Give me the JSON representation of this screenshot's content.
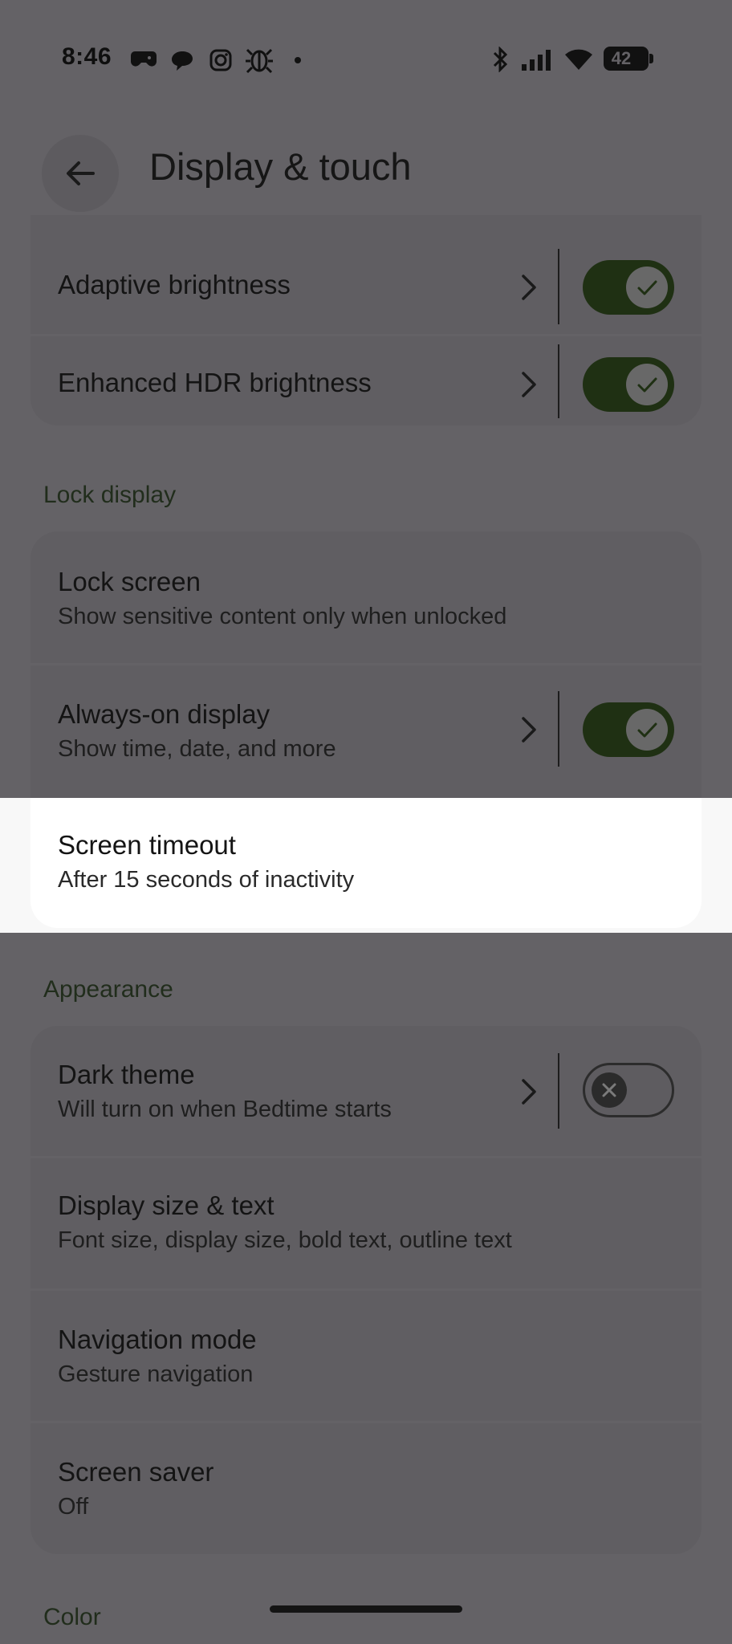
{
  "status_bar": {
    "time": "8:46",
    "battery": "42"
  },
  "header": {
    "title": "Display & touch"
  },
  "brightness_group": {
    "items": [
      {
        "title": "Adaptive brightness",
        "toggle": "on"
      },
      {
        "title": "Enhanced HDR brightness",
        "toggle": "on"
      }
    ]
  },
  "lock_display": {
    "label": "Lock display",
    "items": [
      {
        "title": "Lock screen",
        "subtitle": "Show sensitive content only when unlocked"
      },
      {
        "title": "Always-on display",
        "subtitle": "Show time, date, and more",
        "toggle": "on"
      },
      {
        "title": "Screen timeout",
        "subtitle": "After 15 seconds of inactivity"
      }
    ]
  },
  "appearance": {
    "label": "Appearance",
    "items": [
      {
        "title": "Dark theme",
        "subtitle": "Will turn on when Bedtime starts",
        "toggle": "off"
      },
      {
        "title": "Display size & text",
        "subtitle": "Font size, display size, bold text, outline text"
      },
      {
        "title": "Navigation mode",
        "subtitle": "Gesture navigation"
      },
      {
        "title": "Screen saver",
        "subtitle": "Off"
      }
    ]
  },
  "color_section": {
    "label": "Color"
  },
  "colors": {
    "scrim": "#646266",
    "toggle_on_track": "#1f3013",
    "highlight": "#ffffff"
  }
}
